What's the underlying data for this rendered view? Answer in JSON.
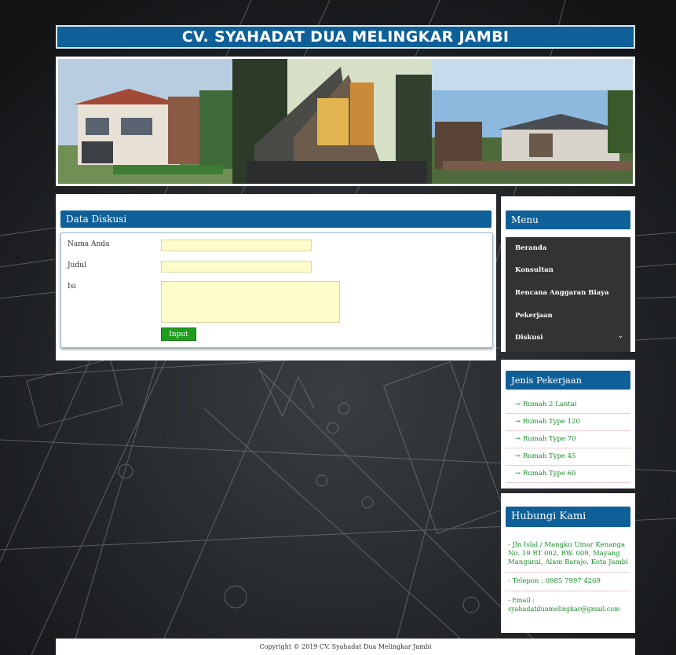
{
  "header": {
    "title": "CV. SYAHADAT DUA MELINGKAR JAMBI"
  },
  "main": {
    "title": "Data Diskusi",
    "fields": {
      "name_label": "Nama Anda",
      "subject_label": "Judul",
      "body_label": "Isi"
    },
    "submit_label": "Input"
  },
  "menu": {
    "title": "Menu",
    "items": [
      "Beranda",
      "Konsultan",
      "Rencana Anggaran Biaya",
      "Pekerjaan",
      "Diskusi"
    ]
  },
  "jenis": {
    "title": "Jenis Pekerjaan",
    "items": [
      "→ Rumah 2 Lantai",
      "→ Rumah Type 120",
      "→ Rumah Type 70",
      "→ Rumah Type 45",
      "→ Rumah Type 60"
    ]
  },
  "kontak": {
    "title": "Hubungi Kami",
    "address": "- Jln Islal / Mangku Umar Kenanga No. 19 RT 002, RW. 009, Mayang Mangurai, Alam Barajo, Kota Jambi",
    "phone": "- Telepon : 0985 7997 4269",
    "email": "- Email : syahadatduamelingkar@gmail.com"
  },
  "footer": {
    "text": "Copyright © 2019 CV. Syahadat Dua Melingkar Jambi"
  }
}
